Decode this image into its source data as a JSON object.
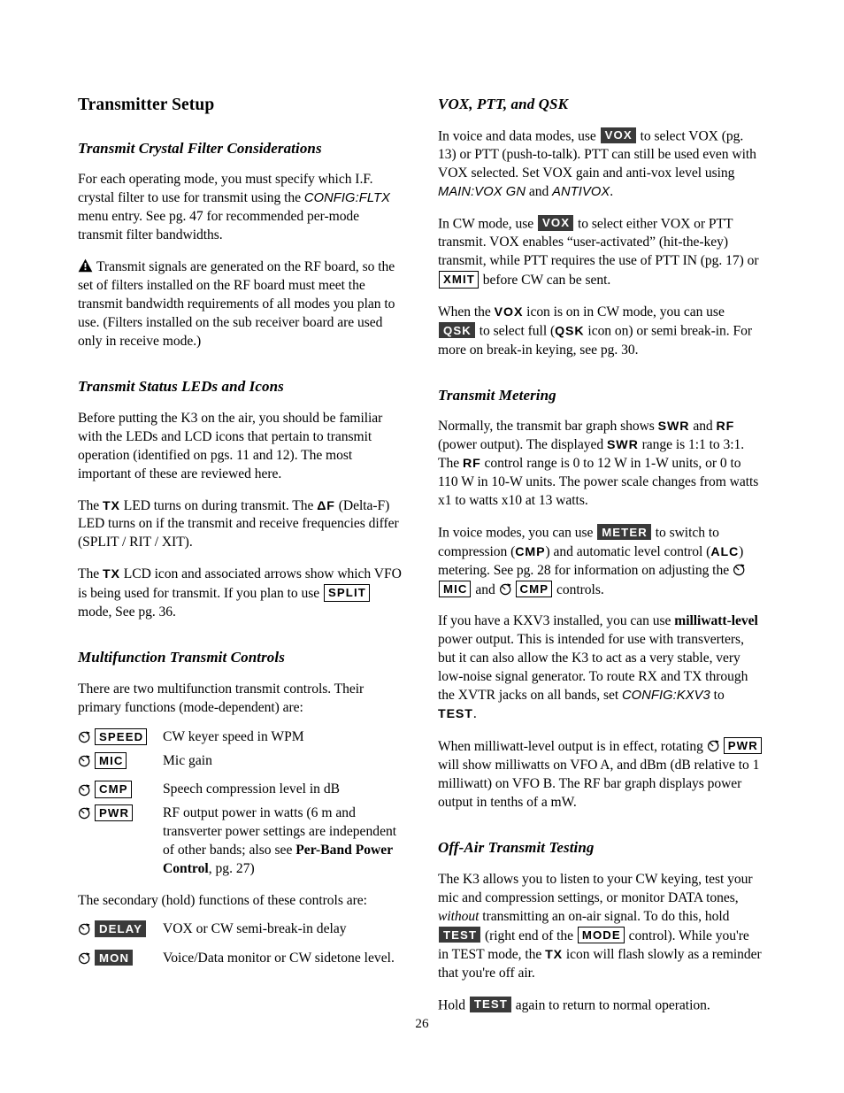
{
  "page": {
    "title": "Transmitter Setup",
    "folio": "26"
  },
  "left_column": {
    "s1": {
      "heading": "Transmit Crystal Filter Considerations",
      "p1_a": "For each operating mode, you must specify which I.F. crystal filter to use for transmit using the ",
      "p1_menu": "CONFIG:FLTX",
      "p1_b": " menu entry. See pg. 47 for recommended per-mode transmit filter bandwidths.",
      "warn_icon": "warning-triangle-icon",
      "p2": "Transmit signals are generated on the RF board, so the set of filters installed on the RF board must meet the transmit bandwidth requirements of all modes you plan to use. (Filters installed on the sub receiver board are used only in receive mode.)"
    },
    "s2": {
      "heading": "Transmit Status LEDs and Icons",
      "p1": "Before putting the K3 on the air, you should be familiar with the LEDs and LCD icons that pertain to transmit operation (identified on pgs. 11 and 12). The most important of these are reviewed here.",
      "p2_a": "The ",
      "p2_tx": "TX",
      "p2_b": " LED turns on during transmit. The ",
      "p2_deltaf": "ΔF",
      "p2_c": " (Delta-F) LED turns on if the transmit and receive frequencies differ (SPLIT / RIT / XIT).",
      "p3_a": "The ",
      "p3_tx": "TX",
      "p3_b": " LCD icon and associated arrows show which VFO is being used for transmit. If you plan to use ",
      "p3_split": "SPLIT",
      "p3_c": " mode, See pg. 36."
    },
    "s3": {
      "heading": "Multifunction Transmit Controls",
      "intro": "There are two multifunction transmit controls. Their primary functions (mode-dependent) are:",
      "primary_controls": [
        {
          "knob_icon": "knob-icon",
          "key": "SPEED",
          "desc": "CW keyer speed in WPM"
        },
        {
          "knob_icon": "knob-icon",
          "key": "MIC",
          "desc": "Mic gain"
        },
        {
          "knob_icon": "knob-icon",
          "key": "CMP",
          "desc": "Speech compression level in dB"
        }
      ],
      "pwr_row": {
        "knob_icon": "knob-icon",
        "key": "PWR",
        "desc_a": "RF output power in watts (6 m and transverter power settings are independent of other bands; also see ",
        "desc_bold": "Per-Band Power Control",
        "desc_b": ", pg. 27)"
      },
      "secondary_intro": "The secondary (hold) functions of these controls are:",
      "secondary_controls": [
        {
          "knob_icon": "knob-icon",
          "key": "DELAY",
          "desc": "VOX or CW semi-break-in delay"
        },
        {
          "knob_icon": "knob-icon",
          "key": "MON",
          "desc": "Voice/Data monitor or CW sidetone level."
        }
      ]
    }
  },
  "right_column": {
    "s1": {
      "heading": "VOX, PTT, and QSK",
      "p1_a": "In voice and data modes, use ",
      "p1_vox": "VOX",
      "p1_b": " to select VOX (pg. 13) or PTT (push-to-talk). PTT can still be used even with VOX selected. Set VOX gain and anti-vox level using ",
      "p1_menu1": "MAIN:VOX GN",
      "p1_c": " and ",
      "p1_menu2": "ANTIVOX",
      "p1_d": ".",
      "p2_a": "In CW mode, use ",
      "p2_vox": "VOX",
      "p2_b": " to select either VOX or PTT transmit. VOX enables “user-activated” (hit-the-key) transmit, while PTT requires the use of PTT IN (pg. 17) or ",
      "p2_xmit": "XMIT",
      "p2_c": " before CW can be sent.",
      "p3_a": "When the ",
      "p3_vox": "VOX",
      "p3_b": " icon is on in CW mode, you can use ",
      "p3_qsk_inv": "QSK",
      "p3_c": " to select full (",
      "p3_qsk": "QSK",
      "p3_d": " icon on) or semi break-in. For more on break-in keying, see pg. 30."
    },
    "s2": {
      "heading": "Transmit Metering",
      "p1_a": "Normally, the transmit bar graph shows ",
      "p1_swr1": "SWR",
      "p1_b": " and ",
      "p1_rf1": "RF",
      "p1_c": " (power output). The displayed ",
      "p1_swr2": "SWR",
      "p1_d": " range is 1:1 to 3:1. The ",
      "p1_rf2": "RF",
      "p1_e": " control range is 0 to 12 W in 1-W units, or 0 to 110 W in 10-W units. The power scale changes from watts x1 to watts x10 at 13 watts.",
      "p2_a": "In voice modes, you can use ",
      "p2_meter": "METER",
      "p2_b": " to switch to compression (",
      "p2_cmp": "CMP",
      "p2_c": ") and automatic level control (",
      "p2_alc": "ALC",
      "p2_d": ") metering. See pg. 28 for information on adjusting the ",
      "p2_mic": "MIC",
      "p2_e": " and ",
      "p2_cmp2": "CMP",
      "p2_f": " controls.",
      "p3_a": "If you have a KXV3 installed, you can use ",
      "p3_bold": "milliwatt-level",
      "p3_b": " power output. This is intended for use with transverters, but it can also allow the K3 to act as a very stable, very low-noise signal generator. To route RX and TX through the XVTR jacks on all bands, set ",
      "p3_menu": "CONFIG:KXV3",
      "p3_c": " to ",
      "p3_test": "TEST",
      "p3_d": ".",
      "p4_a": "When milliwatt-level output is in effect, rotating ",
      "p4_pwr": "PWR",
      "p4_b": " will show milliwatts on VFO A, and dBm (dB relative to 1 milliwatt) on VFO B. The RF bar graph displays power output in tenths of a mW."
    },
    "s3": {
      "heading": "Off-Air Transmit Testing",
      "p1_a": "The K3 allows you to listen to your CW keying, test your mic and compression settings, or monitor DATA tones, ",
      "p1_italic": "without",
      "p1_b": " transmitting an on-air signal. To do this, hold ",
      "p1_test": "TEST",
      "p1_c": " (right end of the ",
      "p1_mode": "MODE",
      "p1_d": " control). While you're in TEST mode, the ",
      "p1_tx": "TX",
      "p1_e": " icon will flash slowly as a reminder that you're off air.",
      "p2_a": "Hold ",
      "p2_test": "TEST",
      "p2_b": " again to return to normal operation."
    }
  }
}
